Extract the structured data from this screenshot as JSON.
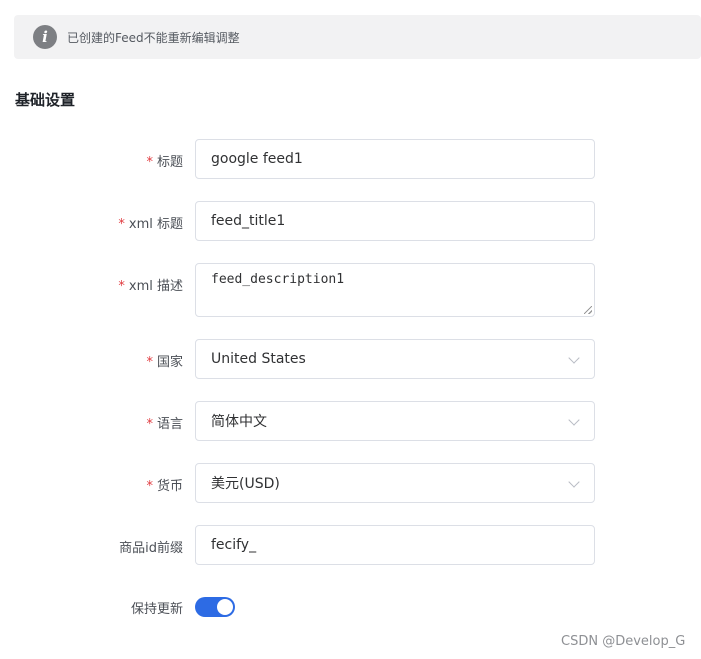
{
  "notice": {
    "icon": "info-icon",
    "text": "已创建的Feed不能重新编辑调整"
  },
  "section": {
    "title": "基础设置"
  },
  "form": {
    "required_mark": "*",
    "title": {
      "label": "标题",
      "value": "google feed1"
    },
    "xml_title": {
      "label": "xml 标题",
      "value": "feed_title1"
    },
    "xml_description": {
      "label": "xml 描述",
      "value": "feed_description1"
    },
    "country": {
      "label": "国家",
      "value": "United States"
    },
    "language": {
      "label": "语言",
      "value": "简体中文"
    },
    "currency": {
      "label": "货币",
      "value": "美元(USD)"
    },
    "product_id_prefix": {
      "label": "商品id前缀",
      "value": "fecify_"
    },
    "keep_updated": {
      "label": "保持更新",
      "enabled": true
    }
  },
  "colors": {
    "accent": "#2d6be4",
    "required": "#e0393e"
  },
  "watermark": "CSDN @Develop_G"
}
